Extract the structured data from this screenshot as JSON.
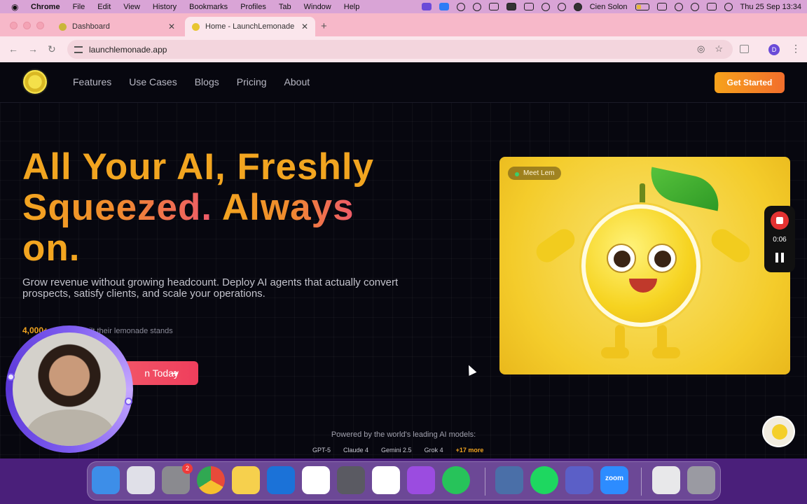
{
  "menubar": {
    "app": "Chrome",
    "items": [
      "File",
      "Edit",
      "View",
      "History",
      "Bookmarks",
      "Profiles",
      "Tab",
      "Window",
      "Help"
    ],
    "user": "Cien Solon",
    "datetime": "Thu 25 Sep  13:34"
  },
  "tabs": [
    {
      "label": "Dashboard",
      "favicon": "dashboard-favicon"
    },
    {
      "label": "Home - LaunchLemonade",
      "favicon": "lemon-favicon",
      "active": true
    }
  ],
  "address": {
    "url": "launchlemonade.app",
    "profile_initial": "D"
  },
  "site": {
    "nav": [
      "Features",
      "Use Cases",
      "Blogs",
      "Pricing",
      "About"
    ],
    "cta_top": "Get Started",
    "hero_line1": "All Your AI, Freshly",
    "hero_line2a": "Squeezed.",
    "hero_line2b": "Always",
    "hero_line3": "on.",
    "subtitle": "Grow revenue without growing headcount. Deploy AI agents that actually convert prospects, satisfy clients, and scale your operations.",
    "stat_number": "4,000+",
    "stat_text": "already built their lemonade stands",
    "cta_main": "n Today",
    "video_badge": "Meet Lem",
    "powered_by": "Powered by the world's leading AI models:",
    "models": [
      "GPT-5",
      "Claude 4",
      "Gemini 2.5",
      "Grok 4"
    ],
    "models_more": "+17 more"
  },
  "recorder": {
    "time": "0:06"
  },
  "dock": {
    "apps": [
      {
        "name": "finder",
        "color": "#3d8ee8"
      },
      {
        "name": "launchpad",
        "color": "#e0e0e8"
      },
      {
        "name": "system-settings",
        "color": "#8a8a8f",
        "badge": "2"
      },
      {
        "name": "chrome",
        "color": "#e84a3a"
      },
      {
        "name": "notes",
        "color": "#f6d04d"
      },
      {
        "name": "trello",
        "color": "#1b72d8"
      },
      {
        "name": "slack",
        "color": "#ffffff"
      },
      {
        "name": "simulator",
        "color": "#5a5a62"
      },
      {
        "name": "news",
        "color": "#ffffff"
      },
      {
        "name": "speeko",
        "color": "#9b4ce0"
      },
      {
        "name": "whatsapp",
        "color": "#27c35a"
      },
      {
        "name": "preview",
        "color": "#4a6fa8"
      },
      {
        "name": "spotify",
        "color": "#1ed760"
      },
      {
        "name": "teams",
        "color": "#5b5fc7"
      },
      {
        "name": "zoom",
        "color": "#2d8cff",
        "label": "zoom"
      },
      {
        "name": "document",
        "color": "#e8e8ea"
      },
      {
        "name": "trash",
        "color": "#9a9aa2"
      }
    ]
  },
  "colors": {
    "accent_orange": "#f2a520",
    "accent_pink": "#ef3e5c",
    "dock_purple": "#4a1f7a"
  }
}
